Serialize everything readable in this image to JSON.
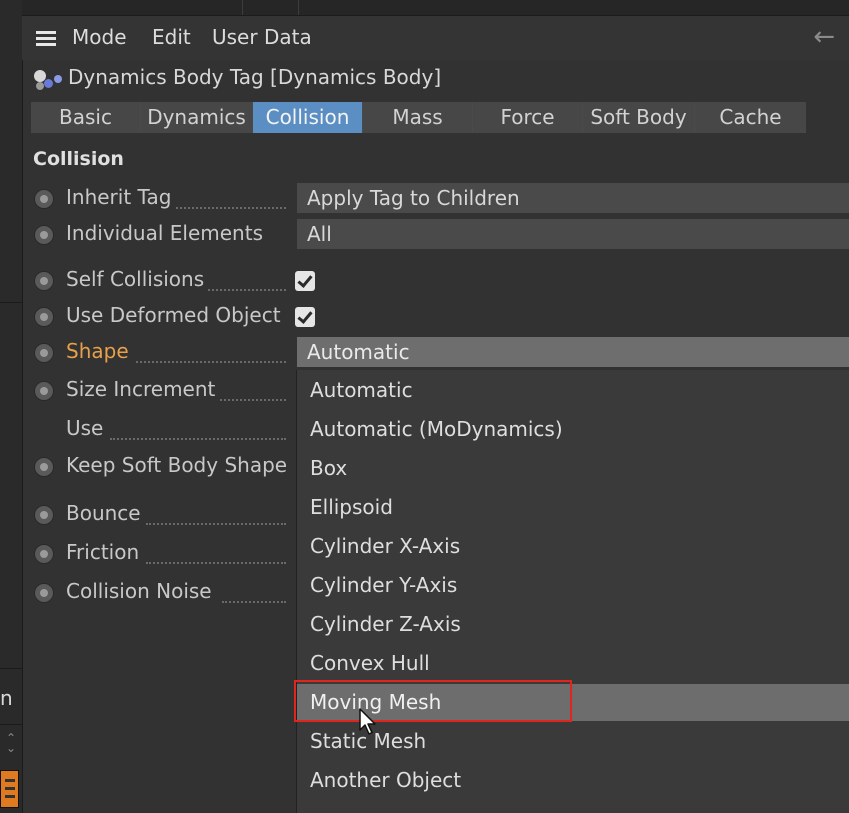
{
  "menu": {
    "items": [
      "Mode",
      "Edit",
      "User Data"
    ]
  },
  "title": "Dynamics Body Tag [Dynamics Body]",
  "tabs": [
    {
      "label": "Basic",
      "active": false
    },
    {
      "label": "Dynamics",
      "active": false
    },
    {
      "label": "Collision",
      "active": true
    },
    {
      "label": "Mass",
      "active": false
    },
    {
      "label": "Force",
      "active": false
    },
    {
      "label": "Soft Body",
      "active": false
    },
    {
      "label": "Cache",
      "active": false
    }
  ],
  "section_title": "Collision",
  "fields": {
    "inherit_tag": {
      "label": "Inherit Tag",
      "value": "Apply Tag to Children"
    },
    "individual_elements": {
      "label": "Individual Elements",
      "value": "All"
    },
    "self_collisions": {
      "label": "Self Collisions",
      "checked": true
    },
    "use_deformed_object": {
      "label": "Use Deformed Object",
      "checked": true
    },
    "shape": {
      "label": "Shape",
      "value": "Automatic"
    },
    "size_increment": {
      "label": "Size Increment"
    },
    "use": {
      "label": "Use"
    },
    "keep_soft_body_shape": {
      "label": "Keep Soft Body Shape"
    },
    "bounce": {
      "label": "Bounce"
    },
    "friction": {
      "label": "Friction"
    },
    "collision_noise": {
      "label": "Collision Noise"
    }
  },
  "shape_options": [
    "Automatic",
    "Automatic (MoDynamics)",
    "Box",
    "Ellipsoid",
    "Cylinder X-Axis",
    "Cylinder Y-Axis",
    "Cylinder Z-Axis",
    "Convex Hull",
    "Moving Mesh",
    "Static Mesh",
    "Another Object"
  ],
  "highlighted_option": "Moving Mesh",
  "left_strip_letter": "n",
  "colors": {
    "active_tab": "#5b8ec2",
    "accent_label": "#e8a04a",
    "highlight_box": "#e0251f"
  }
}
